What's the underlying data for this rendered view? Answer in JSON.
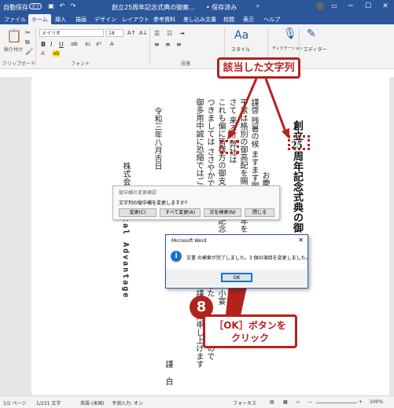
{
  "titlebar": {
    "autosave_label": "自動保存",
    "autosave_state": "オフ",
    "doc_title": "創立25周年記念式典の御案…",
    "save_status": "• 保存済み",
    "search_placeholder": "検索"
  },
  "menu": {
    "tabs": [
      "ファイル",
      "ホーム",
      "挿入",
      "描画",
      "デザイン",
      "レイアウト",
      "参考資料",
      "差し込み文書",
      "校閲",
      "表示",
      "ヘルプ"
    ],
    "active": "ホーム"
  },
  "ribbon": {
    "paste_label": "貼り付け",
    "clipboard_group": "クリップボード",
    "font_name": "メイリオ",
    "font_size": "18",
    "font_group": "フォント",
    "paragraph_group": "段落",
    "style_label": "スタイル",
    "dictation_label": "ディクテーション",
    "editor_label": "エディター",
    "voice_group": "音声",
    "editor_group": "エディター",
    "bold": "B",
    "italic": "I",
    "underline": "U"
  },
  "document": {
    "heading_prefix": "創立",
    "heading_number": "25",
    "heading_rest": "周年記念式典の御",
    "col1": "謹啓 残暑の候 ますます御",
    "col2": "平素は格別の御高配を賜り 厚",
    "col3": "さて 来る",
    "col3_number": "25",
    "col3_rest": "弊社は",
    "col4": "これも偏に皆様方の御支援御指",
    "col5": "つきましては ささやかではご",
    "col6": "御多用中誠に恐縮ではございま",
    "right_a": "お慶",
    "right_b": "上げ",
    "right_c": "年を",
    "right_d": "深く",
    "right_e": "記念",
    "right_f": "ました",
    "right_g": "小宴",
    "right_h": "謹んで",
    "right_i": "内申し上げます",
    "date": "令和三年八月吉日",
    "company_prefix": "株式会",
    "company_latin": "tal Advantage",
    "sender_1": "謹",
    "sender_2": "白",
    "tail": "すので",
    "tail2": "ます"
  },
  "dialog_replace": {
    "title": "縦中横の変更確認",
    "question": "文字列の縦中横を変更しますか?",
    "buttons": [
      "変更(C)",
      "すべて変更(A)",
      "次を検索(N)",
      "閉じる"
    ]
  },
  "dialog_word": {
    "title": "Microsoft Word",
    "message": "文書 の検索が完了しました。3 個の項目を変更しました。",
    "ok": "OK",
    "info_glyph": "i"
  },
  "annotations": {
    "callout_top": "該当した文字列",
    "step_number": "8",
    "callout_bottom_line1": "［OK］ボタンを",
    "callout_bottom_line2": "クリック",
    "highlight_color": "#b4221c"
  },
  "statusbar": {
    "page": "1/1 ページ",
    "words": "1/231 文字",
    "language": "英語 (米国)",
    "predict": "予測入力: オン",
    "focus": "フォーカス",
    "zoom": "100%"
  },
  "colors": {
    "word_blue": "#2b579a",
    "accent_red": "#b4221c"
  }
}
